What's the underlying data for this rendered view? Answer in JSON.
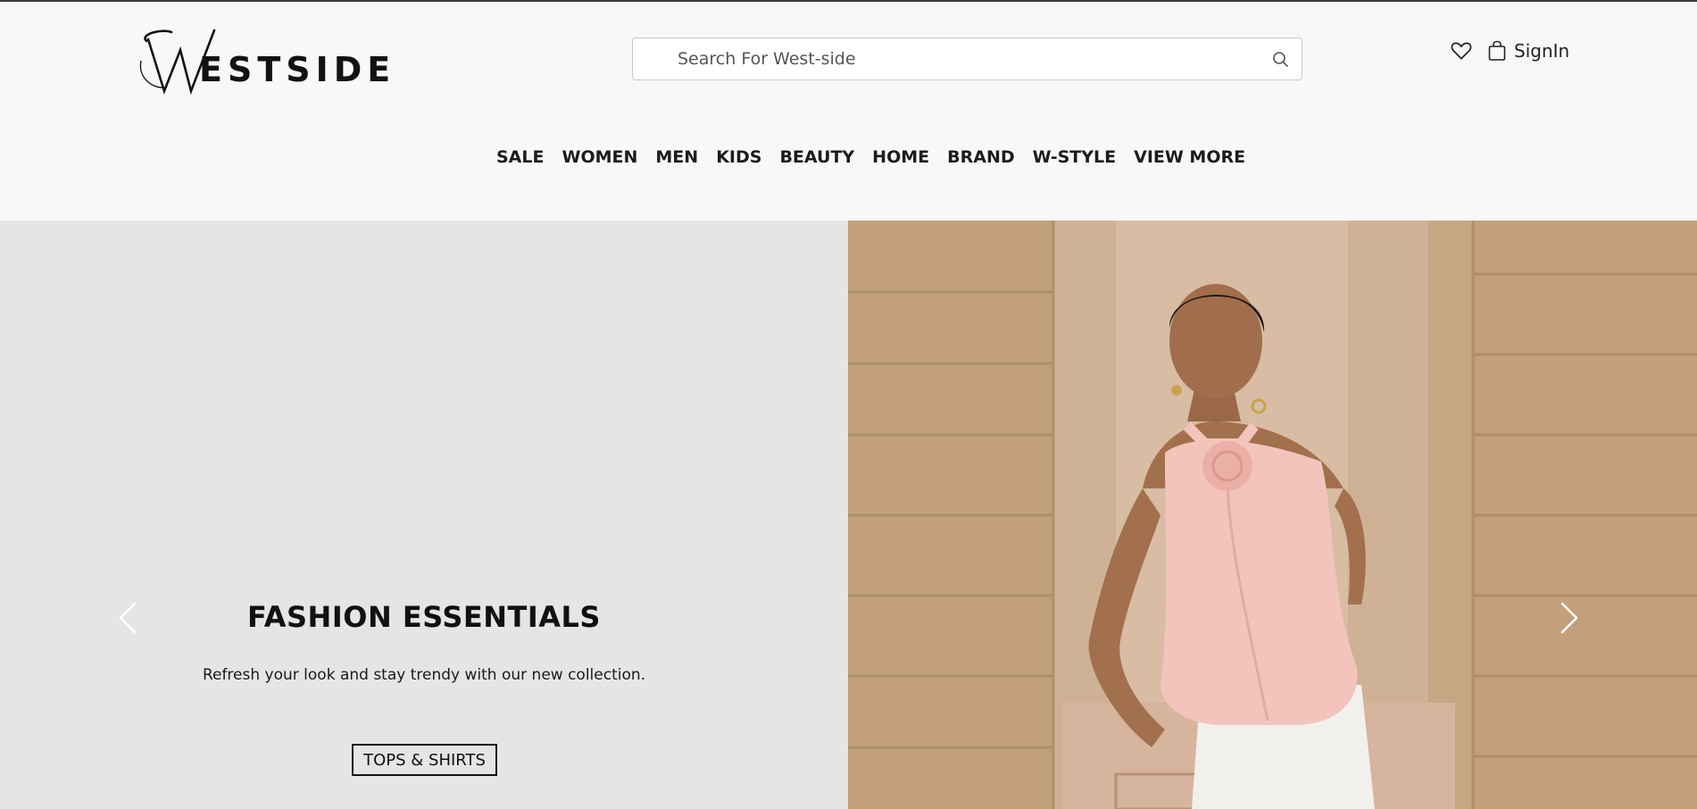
{
  "brand": {
    "logo_text": "ESTSIDE",
    "logo_initial": "W"
  },
  "search": {
    "placeholder": "Search For West-side",
    "value": ""
  },
  "header_actions": {
    "signin_label": "SignIn"
  },
  "nav": {
    "items": [
      {
        "label": "SALE"
      },
      {
        "label": "WOMEN"
      },
      {
        "label": "MEN"
      },
      {
        "label": "KIDS"
      },
      {
        "label": "BEAUTY"
      },
      {
        "label": "HOME"
      },
      {
        "label": "BRAND"
      },
      {
        "label": "W-STYLE"
      },
      {
        "label": "VIEW MORE"
      }
    ]
  },
  "hero": {
    "title": "FASHION ESSENTIALS",
    "subtitle": "Refresh your look and stay trendy with our new collection.",
    "cta_label": "TOPS & SHIRTS"
  },
  "colors": {
    "header_bg": "#f8f8f9",
    "hero_left_bg": "#e5e5e5",
    "wall": "#c9a886",
    "top": "#f2c4bc"
  },
  "icons": [
    "search-icon",
    "heart-icon",
    "shopping-bag-icon",
    "chevron-left-icon",
    "chevron-right-icon"
  ]
}
